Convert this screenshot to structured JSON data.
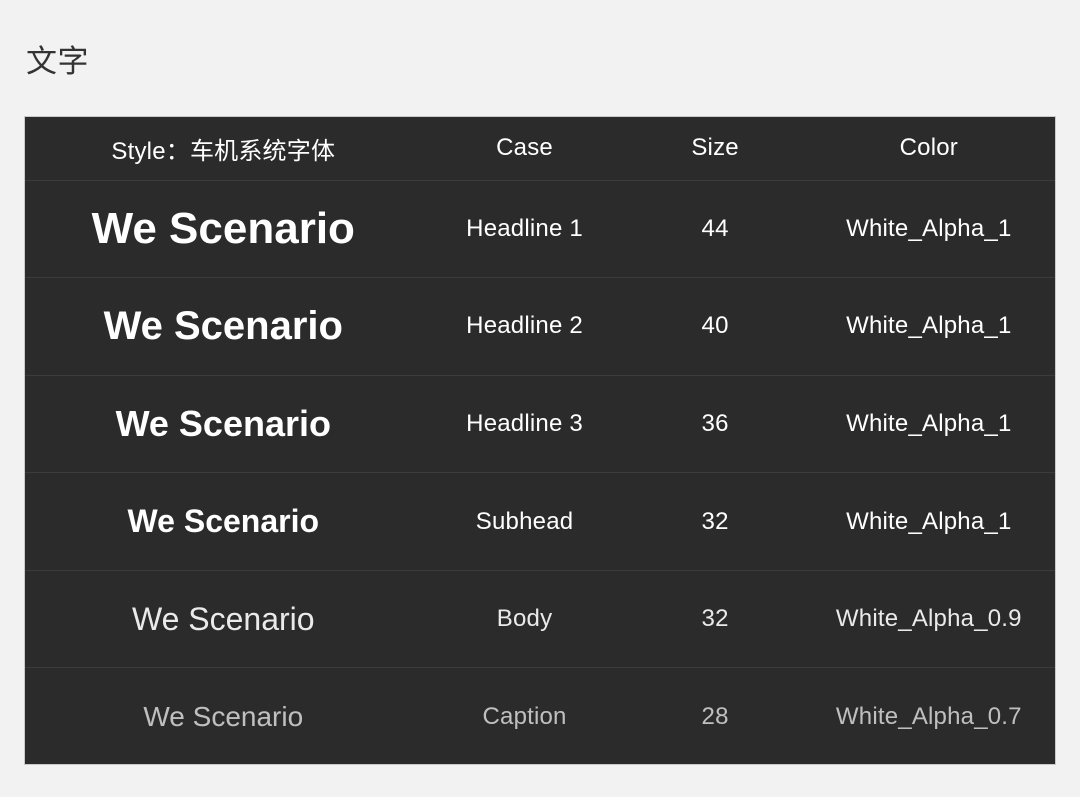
{
  "section": {
    "title": "文字"
  },
  "spec_table": {
    "columns": [
      {
        "key": "style",
        "label": "Style：车机系统字体"
      },
      {
        "key": "case",
        "label": "Case"
      },
      {
        "key": "size",
        "label": "Size"
      },
      {
        "key": "color",
        "label": "Color"
      }
    ],
    "rows": [
      {
        "sample": "We Scenario",
        "case": "Headline 1",
        "size": "44",
        "color": "White_Alpha_1"
      },
      {
        "sample": "We Scenario",
        "case": "Headline 2",
        "size": "40",
        "color": "White_Alpha_1"
      },
      {
        "sample": "We Scenario",
        "case": "Headline 3",
        "size": "36",
        "color": "White_Alpha_1"
      },
      {
        "sample": "We Scenario",
        "case": "Subhead",
        "size": "32",
        "color": "White_Alpha_1"
      },
      {
        "sample": "We Scenario",
        "case": "Body",
        "size": "32",
        "color": "White_Alpha_0.9"
      },
      {
        "sample": "We Scenario",
        "case": "Caption",
        "size": "28",
        "color": "White_Alpha_0.7"
      }
    ]
  },
  "colors": {
    "page_background": "#f2f2f2",
    "card_background": "#2b2b2b",
    "card_border": "#c9c9c9",
    "row_divider": "#3c3c3c",
    "title_text": "#333333",
    "table_text": "#ffffff"
  }
}
